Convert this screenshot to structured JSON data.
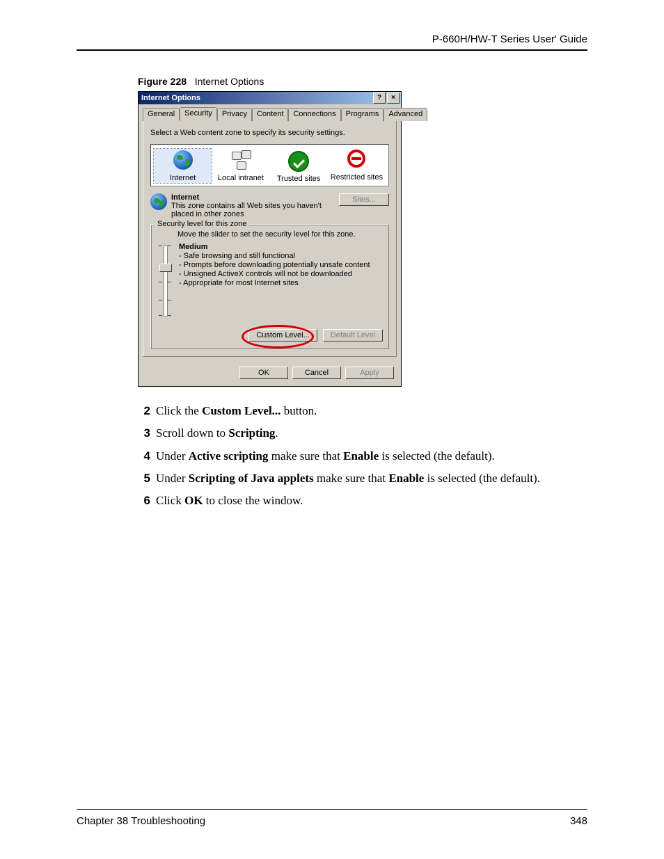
{
  "doc": {
    "header": "P-660H/HW-T Series User' Guide",
    "figure_label": "Figure 228",
    "figure_title": "Internet Options",
    "footer_chapter": "Chapter 38 Troubleshooting",
    "footer_page": "348"
  },
  "dialog": {
    "title": "Internet Options",
    "help_glyph": "?",
    "close_glyph": "×",
    "tabs": [
      "General",
      "Security",
      "Privacy",
      "Content",
      "Connections",
      "Programs",
      "Advanced"
    ],
    "active_tab_index": 1,
    "instruction": "Select a Web content zone to specify its security settings.",
    "zones": [
      {
        "label": "Internet",
        "selected": true
      },
      {
        "label": "Local intranet",
        "selected": false
      },
      {
        "label": "Trusted sites",
        "selected": false
      },
      {
        "label": "Restricted sites",
        "selected": false
      }
    ],
    "zone_detail": {
      "name": "Internet",
      "desc": "This zone contains all Web sites you haven't placed in other zones",
      "sites_btn": "Sites..."
    },
    "security_box": {
      "legend": "Security level for this zone",
      "move_slider": "Move the slider to set the security level for this zone.",
      "level_name": "Medium",
      "bullets": [
        "- Safe browsing and still functional",
        "- Prompts before downloading potentially unsafe content",
        "- Unsigned ActiveX controls will not be downloaded",
        "- Appropriate for most Internet sites"
      ],
      "custom_btn": "Custom Level...",
      "default_btn": "Default Level"
    },
    "footer_buttons": {
      "ok": "OK",
      "cancel": "Cancel",
      "apply": "Apply"
    }
  },
  "steps": [
    {
      "n": "2",
      "parts": [
        {
          "t": "Click the "
        },
        {
          "t": "Custom Level...",
          "b": true
        },
        {
          "t": " button."
        }
      ]
    },
    {
      "n": "3",
      "parts": [
        {
          "t": "Scroll down to "
        },
        {
          "t": "Scripting",
          "b": true
        },
        {
          "t": "."
        }
      ]
    },
    {
      "n": "4",
      "parts": [
        {
          "t": "Under "
        },
        {
          "t": "Active scripting",
          "b": true
        },
        {
          "t": " make sure that "
        },
        {
          "t": "Enable",
          "b": true
        },
        {
          "t": " is selected (the default)."
        }
      ]
    },
    {
      "n": "5",
      "parts": [
        {
          "t": "Under "
        },
        {
          "t": "Scripting of Java applets",
          "b": true
        },
        {
          "t": " make sure that "
        },
        {
          "t": "Enable",
          "b": true
        },
        {
          "t": " is selected (the default)."
        }
      ]
    },
    {
      "n": "6",
      "parts": [
        {
          "t": "Click "
        },
        {
          "t": "OK",
          "b": true
        },
        {
          "t": " to close the window."
        }
      ]
    }
  ]
}
